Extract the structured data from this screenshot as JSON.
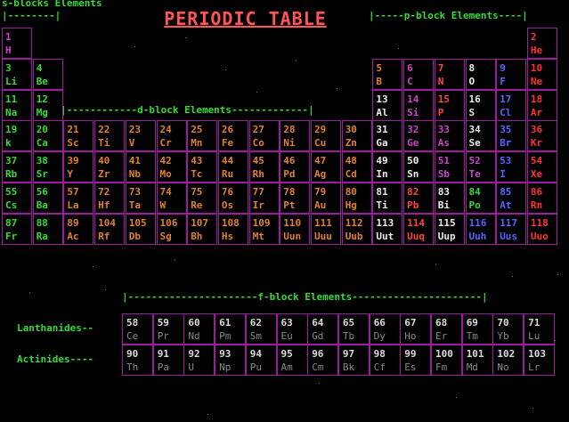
{
  "title": "PERIODIC TABLE",
  "labels": {
    "s_block": "s-blocks Elements",
    "s_bracket": "|--------|",
    "p_block": "|-----p-block Elements----|",
    "d_block": "|------------d-block Elements-------------|",
    "f_block": "|----------------------f-block Elements----------------------|",
    "lanthanides": "Lanthanides--",
    "actinides": "Actinides----"
  },
  "colors": {
    "grid_border": "#a01aa0",
    "label_green": "#33dd33",
    "title_red": "#ff5555",
    "alkali": "#33dd33",
    "alkaline_earth": "#33dd33",
    "transition": "#e08030",
    "post_transition": "#eeeeee",
    "metalloid": "#aa55ff",
    "nonmetal": "#ff4444",
    "halogen": "#5566ff",
    "noble_gas": "#ff3333",
    "lanthanide_actinide": "#dddddd"
  },
  "elements": [
    {
      "n": "1",
      "s": "H",
      "c": "#cc44cc",
      "r": 0,
      "col": 0
    },
    {
      "n": "2",
      "s": "He",
      "c": "#ff3333",
      "r": 0,
      "col": 17
    },
    {
      "n": "3",
      "s": "Li",
      "c": "#33dd33",
      "r": 1,
      "col": 0
    },
    {
      "n": "4",
      "s": "Be",
      "c": "#33dd33",
      "r": 1,
      "col": 1
    },
    {
      "n": "5",
      "s": "B",
      "c": "#e08030",
      "r": 1,
      "col": 12
    },
    {
      "n": "6",
      "s": "C",
      "c": "#cc44cc",
      "r": 1,
      "col": 13
    },
    {
      "n": "7",
      "s": "N",
      "c": "#ff4444",
      "r": 1,
      "col": 14
    },
    {
      "n": "8",
      "s": "O",
      "c": "#eeeeee",
      "r": 1,
      "col": 15
    },
    {
      "n": "9",
      "s": "F",
      "c": "#5566ff",
      "r": 1,
      "col": 16
    },
    {
      "n": "10",
      "s": "Ne",
      "c": "#ff3333",
      "r": 1,
      "col": 17
    },
    {
      "n": "11",
      "s": "Na",
      "c": "#33dd33",
      "r": 2,
      "col": 0
    },
    {
      "n": "12",
      "s": "Mg",
      "c": "#33dd33",
      "r": 2,
      "col": 1
    },
    {
      "n": "13",
      "s": "Al",
      "c": "#eeeeee",
      "r": 2,
      "col": 12
    },
    {
      "n": "14",
      "s": "Si",
      "c": "#cc44cc",
      "r": 2,
      "col": 13
    },
    {
      "n": "15",
      "s": "P",
      "c": "#ff4444",
      "r": 2,
      "col": 14
    },
    {
      "n": "16",
      "s": "S",
      "c": "#eeeeee",
      "r": 2,
      "col": 15
    },
    {
      "n": "17",
      "s": "Cl",
      "c": "#5566ff",
      "r": 2,
      "col": 16
    },
    {
      "n": "18",
      "s": "Ar",
      "c": "#ff3333",
      "r": 2,
      "col": 17
    },
    {
      "n": "19",
      "s": "k",
      "c": "#33dd33",
      "r": 3,
      "col": 0
    },
    {
      "n": "20",
      "s": "Ca",
      "c": "#33dd33",
      "r": 3,
      "col": 1
    },
    {
      "n": "21",
      "s": "Sc",
      "c": "#e08030",
      "r": 3,
      "col": 2
    },
    {
      "n": "22",
      "s": "Ti",
      "c": "#e08030",
      "r": 3,
      "col": 3
    },
    {
      "n": "23",
      "s": "V",
      "c": "#e08030",
      "r": 3,
      "col": 4
    },
    {
      "n": "24",
      "s": "Cr",
      "c": "#e08030",
      "r": 3,
      "col": 5
    },
    {
      "n": "25",
      "s": "Mn",
      "c": "#e08030",
      "r": 3,
      "col": 6
    },
    {
      "n": "26",
      "s": "Fe",
      "c": "#e08030",
      "r": 3,
      "col": 7
    },
    {
      "n": "27",
      "s": "Co",
      "c": "#e08030",
      "r": 3,
      "col": 8
    },
    {
      "n": "28",
      "s": "Ni",
      "c": "#e08030",
      "r": 3,
      "col": 9
    },
    {
      "n": "29",
      "s": "Cu",
      "c": "#e08030",
      "r": 3,
      "col": 10
    },
    {
      "n": "30",
      "s": "Zn",
      "c": "#e08030",
      "r": 3,
      "col": 11
    },
    {
      "n": "31",
      "s": "Ga",
      "c": "#eeeeee",
      "r": 3,
      "col": 12
    },
    {
      "n": "32",
      "s": "Ge",
      "c": "#cc44cc",
      "r": 3,
      "col": 13
    },
    {
      "n": "33",
      "s": "As",
      "c": "#cc44cc",
      "r": 3,
      "col": 14
    },
    {
      "n": "34",
      "s": "Se",
      "c": "#eeeeee",
      "r": 3,
      "col": 15
    },
    {
      "n": "35",
      "s": "Br",
      "c": "#5566ff",
      "r": 3,
      "col": 16
    },
    {
      "n": "36",
      "s": "Kr",
      "c": "#ff3333",
      "r": 3,
      "col": 17
    },
    {
      "n": "37",
      "s": "Rb",
      "c": "#33dd33",
      "r": 4,
      "col": 0
    },
    {
      "n": "38",
      "s": "Sr",
      "c": "#33dd33",
      "r": 4,
      "col": 1
    },
    {
      "n": "39",
      "s": "Y",
      "c": "#e08030",
      "r": 4,
      "col": 2
    },
    {
      "n": "40",
      "s": "Zr",
      "c": "#e08030",
      "r": 4,
      "col": 3
    },
    {
      "n": "41",
      "s": "Nb",
      "c": "#e08030",
      "r": 4,
      "col": 4
    },
    {
      "n": "42",
      "s": "Mo",
      "c": "#e08030",
      "r": 4,
      "col": 5
    },
    {
      "n": "43",
      "s": "Tc",
      "c": "#e08030",
      "r": 4,
      "col": 6
    },
    {
      "n": "44",
      "s": "Ru",
      "c": "#e08030",
      "r": 4,
      "col": 7
    },
    {
      "n": "45",
      "s": "Rh",
      "c": "#e08030",
      "r": 4,
      "col": 8
    },
    {
      "n": "46",
      "s": "Pd",
      "c": "#e08030",
      "r": 4,
      "col": 9
    },
    {
      "n": "47",
      "s": "Ag",
      "c": "#e08030",
      "r": 4,
      "col": 10
    },
    {
      "n": "48",
      "s": "Cd",
      "c": "#e08030",
      "r": 4,
      "col": 11
    },
    {
      "n": "49",
      "s": "In",
      "c": "#eeeeee",
      "r": 4,
      "col": 12
    },
    {
      "n": "50",
      "s": "Sn",
      "c": "#eeeeee",
      "r": 4,
      "col": 13
    },
    {
      "n": "51",
      "s": "Sb",
      "c": "#cc44cc",
      "r": 4,
      "col": 14
    },
    {
      "n": "52",
      "s": "Te",
      "c": "#cc44cc",
      "r": 4,
      "col": 15
    },
    {
      "n": "53",
      "s": "I",
      "c": "#5566ff",
      "r": 4,
      "col": 16
    },
    {
      "n": "54",
      "s": "Xe",
      "c": "#ff3333",
      "r": 4,
      "col": 17
    },
    {
      "n": "55",
      "s": "Cs",
      "c": "#33dd33",
      "r": 5,
      "col": 0
    },
    {
      "n": "56",
      "s": "Ba",
      "c": "#33dd33",
      "r": 5,
      "col": 1
    },
    {
      "n": "57",
      "s": "La",
      "c": "#e08030",
      "r": 5,
      "col": 2
    },
    {
      "n": "72",
      "s": "Hf",
      "c": "#e08030",
      "r": 5,
      "col": 3
    },
    {
      "n": "73",
      "s": "Ta",
      "c": "#e08030",
      "r": 5,
      "col": 4
    },
    {
      "n": "74",
      "s": "W",
      "c": "#e08030",
      "r": 5,
      "col": 5
    },
    {
      "n": "75",
      "s": "Re",
      "c": "#e08030",
      "r": 5,
      "col": 6
    },
    {
      "n": "76",
      "s": "Os",
      "c": "#e08030",
      "r": 5,
      "col": 7
    },
    {
      "n": "77",
      "s": "Ir",
      "c": "#e08030",
      "r": 5,
      "col": 8
    },
    {
      "n": "78",
      "s": "Pt",
      "c": "#e08030",
      "r": 5,
      "col": 9
    },
    {
      "n": "79",
      "s": "Au",
      "c": "#e08030",
      "r": 5,
      "col": 10
    },
    {
      "n": "80",
      "s": "Hg",
      "c": "#e08030",
      "r": 5,
      "col": 11
    },
    {
      "n": "81",
      "s": "Ti",
      "c": "#eeeeee",
      "r": 5,
      "col": 12
    },
    {
      "n": "82",
      "s": "Pb",
      "c": "#ff4444",
      "r": 5,
      "col": 13
    },
    {
      "n": "83",
      "s": "Bi",
      "c": "#eeeeee",
      "r": 5,
      "col": 14
    },
    {
      "n": "84",
      "s": "Po",
      "c": "#33dd33",
      "r": 5,
      "col": 15
    },
    {
      "n": "85",
      "s": "At",
      "c": "#5566ff",
      "r": 5,
      "col": 16
    },
    {
      "n": "86",
      "s": "Rn",
      "c": "#ff3333",
      "r": 5,
      "col": 17
    },
    {
      "n": "87",
      "s": "Fr",
      "c": "#33dd33",
      "r": 6,
      "col": 0
    },
    {
      "n": "88",
      "s": "Ra",
      "c": "#33dd33",
      "r": 6,
      "col": 1
    },
    {
      "n": "89",
      "s": "Ac",
      "c": "#e08030",
      "r": 6,
      "col": 2
    },
    {
      "n": "104",
      "s": "Rf",
      "c": "#e08030",
      "r": 6,
      "col": 3
    },
    {
      "n": "105",
      "s": "Db",
      "c": "#e08030",
      "r": 6,
      "col": 4
    },
    {
      "n": "106",
      "s": "Sg",
      "c": "#e08030",
      "r": 6,
      "col": 5
    },
    {
      "n": "107",
      "s": "Bh",
      "c": "#e08030",
      "r": 6,
      "col": 6
    },
    {
      "n": "108",
      "s": "Hs",
      "c": "#e08030",
      "r": 6,
      "col": 7
    },
    {
      "n": "109",
      "s": "Mt",
      "c": "#e08030",
      "r": 6,
      "col": 8
    },
    {
      "n": "110",
      "s": "Uun",
      "c": "#e08030",
      "r": 6,
      "col": 9
    },
    {
      "n": "111",
      "s": "Uuu",
      "c": "#e08030",
      "r": 6,
      "col": 10
    },
    {
      "n": "112",
      "s": "Uub",
      "c": "#e08030",
      "r": 6,
      "col": 11
    },
    {
      "n": "113",
      "s": "Uut",
      "c": "#eeeeee",
      "r": 6,
      "col": 12
    },
    {
      "n": "114",
      "s": "Uuq",
      "c": "#ff4444",
      "r": 6,
      "col": 13
    },
    {
      "n": "115",
      "s": "Uup",
      "c": "#eeeeee",
      "r": 6,
      "col": 14
    },
    {
      "n": "116",
      "s": "Uuh",
      "c": "#5566ff",
      "r": 6,
      "col": 15
    },
    {
      "n": "117",
      "s": "Uus",
      "c": "#5566ff",
      "r": 6,
      "col": 16
    },
    {
      "n": "118",
      "s": "Uuo",
      "c": "#ff3333",
      "r": 6,
      "col": 17
    }
  ],
  "lanthanides": [
    {
      "n": "58",
      "s": "Ce"
    },
    {
      "n": "59",
      "s": "Pr"
    },
    {
      "n": "60",
      "s": "Nd"
    },
    {
      "n": "61",
      "s": "Pm"
    },
    {
      "n": "62",
      "s": "Sm"
    },
    {
      "n": "63",
      "s": "Eu"
    },
    {
      "n": "64",
      "s": "Gd"
    },
    {
      "n": "65",
      "s": "Tb"
    },
    {
      "n": "66",
      "s": "Dy"
    },
    {
      "n": "67",
      "s": "Ho"
    },
    {
      "n": "68",
      "s": "Er"
    },
    {
      "n": "69",
      "s": "Tm"
    },
    {
      "n": "70",
      "s": "Yb"
    },
    {
      "n": "71",
      "s": "Lu"
    }
  ],
  "actinides": [
    {
      "n": "90",
      "s": "Th"
    },
    {
      "n": "91",
      "s": "Pa"
    },
    {
      "n": "92",
      "s": "U"
    },
    {
      "n": "93",
      "s": "Np"
    },
    {
      "n": "94",
      "s": "Pu"
    },
    {
      "n": "95",
      "s": "Am"
    },
    {
      "n": "96",
      "s": "Cm"
    },
    {
      "n": "97",
      "s": "Bk"
    },
    {
      "n": "98",
      "s": "Cf"
    },
    {
      "n": "99",
      "s": "Es"
    },
    {
      "n": "100",
      "s": "Fm"
    },
    {
      "n": "101",
      "s": "Md"
    },
    {
      "n": "102",
      "s": "No"
    },
    {
      "n": "103",
      "s": "Lr"
    }
  ]
}
